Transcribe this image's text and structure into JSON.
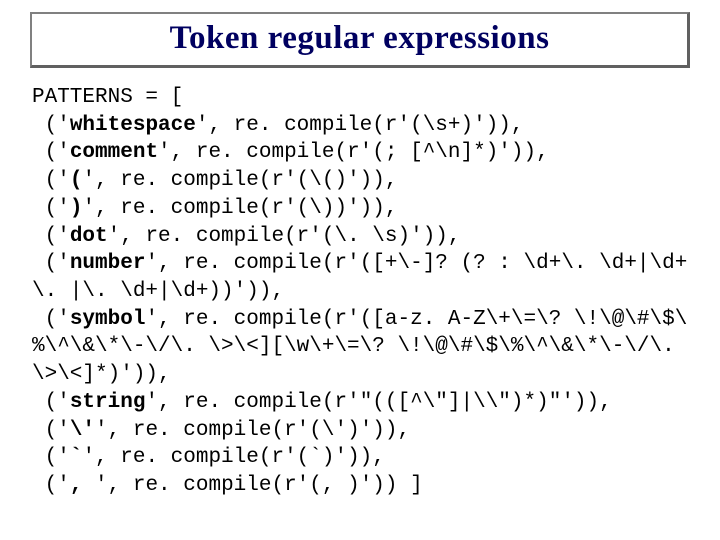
{
  "title": "Token regular expressions",
  "code": {
    "l01a": "PATTERNS = [",
    "l02a": " ('",
    "l02b": "whitespace",
    "l02c": "', re. compile(r'(\\s+)')),",
    "l03a": " ('",
    "l03b": "comment",
    "l03c": "', re. compile(r'(; [^\\n]*)')),",
    "l04a": " ('",
    "l04b": "(",
    "l04c": "', re. compile(r'(\\()')),",
    "l05a": " ('",
    "l05b": ")",
    "l05c": "', re. compile(r'(\\))')),",
    "l06a": " ('",
    "l06b": "dot",
    "l06c": "', re. compile(r'(\\. \\s)')),",
    "l07a": " ('",
    "l07b": "number",
    "l07c": "', re. compile(r'([+\\-]? (? : \\d+\\. \\d+|\\d+\\. |\\. \\d+|\\d+))')),",
    "l08a": " ('",
    "l08b": "symbol",
    "l08c": "', re. compile(r'([a-z. A-Z\\+\\=\\? \\!\\@\\#\\$\\%\\^\\&\\*\\-\\/\\. \\>\\<][\\w\\+\\=\\? \\!\\@\\#\\$\\%\\^\\&\\*\\-\\/\\. \\>\\<]*)')),",
    "l09a": " ('",
    "l09b": "string",
    "l09c": "', re. compile(r'\"(([^\\\"]|\\\\\")*)\"')),",
    "l10a": " ('",
    "l10b": "\\'",
    "l10c": "', re. compile(r'(\\')')),",
    "l11a": " ('",
    "l11b": "`",
    "l11c": "', re. compile(r'(`)')),",
    "l12a": " ('",
    "l12b": ", ",
    "l12c": "', re. compile(r'(, )')) ]"
  }
}
